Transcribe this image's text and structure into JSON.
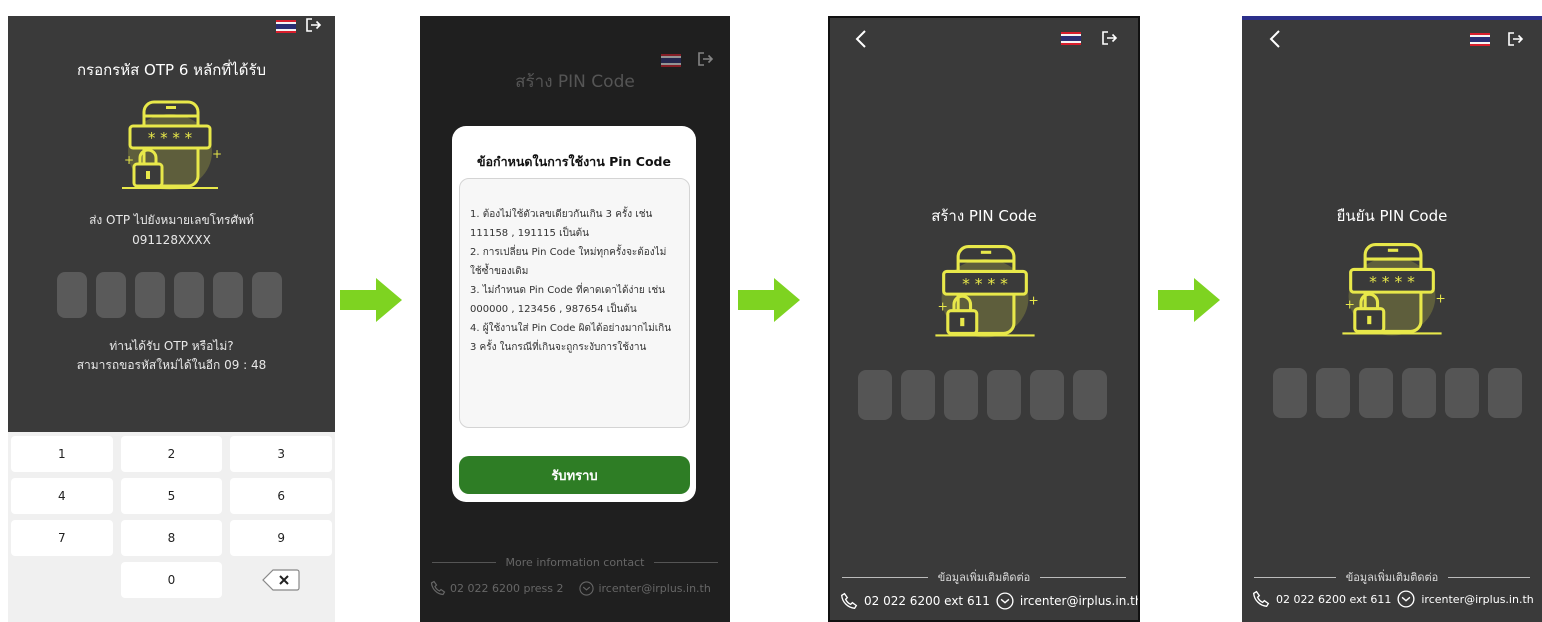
{
  "otp_screen": {
    "title": "กรอกรหัส OTP 6 หลักที่ได้รับ",
    "sent_line1": "ส่ง OTP ไปยังหมายเลขโทรศัพท์",
    "sent_line2": "091128XXXX",
    "otp_box_count": 6,
    "not_received": "ท่านได้รับ OTP หรือไม่?",
    "resend_countdown": "สามารถขอรหัสใหม่ได้ในอีก 09 : 48",
    "keypad": [
      "1",
      "2",
      "3",
      "4",
      "5",
      "6",
      "7",
      "8",
      "9",
      "",
      "0",
      "⌫"
    ]
  },
  "rules_screen": {
    "bg_title": "สร้าง PIN Code",
    "modal_title": "ข้อกำหนดในการใช้งาน Pin Code",
    "rules": [
      "1. ต้องไม่ใช้ตัวเลขเดียวกันเกิน 3 ครั้ง เช่น",
      "111158 , 191115 เป็นต้น",
      "2. การเปลี่ยน Pin Code ใหม่ทุกครั้งจะต้องไม่",
      "ใช้ซ้ำของเดิม",
      "3. ไม่กำหนด Pin Code ที่คาดเดาได้ง่าย เช่น",
      "000000 , 123456 , 987654 เป็นต้น",
      "4. ผู้ใช้งานใส่ Pin Code ผิดได้อย่างมากไม่เกิน",
      "3 ครั้ง ในกรณีที่เกินจะถูกระงับการใช้งาน"
    ],
    "accept_label": "รับทราบ",
    "contact_heading": "More information contact",
    "phone": "02 022 6200 press 2",
    "email": "ircenter@irplus.in.th"
  },
  "create_pin_screen": {
    "title": "สร้าง PIN Code",
    "pin_box_count": 6,
    "contact_heading": "ข้อมูลเพิ่มเติมติดต่อ",
    "phone": "02 022 6200 ext 611",
    "email": "ircenter@irplus.in.th"
  },
  "confirm_pin_screen": {
    "title": "ยืนยัน PIN Code",
    "pin_box_count": 6,
    "contact_heading": "ข้อมูลเพิ่มเติมติดต่อ",
    "phone": "02 022 6200 ext 611",
    "email": "ircenter@irplus.in.th"
  },
  "colors": {
    "screen_bg": "#3a3a3a",
    "accent_yellow": "#e8e84a",
    "button_green": "#2e7d25",
    "arrow_green": "#7ed321"
  },
  "icons": [
    "thai-flag-icon",
    "logout-icon",
    "back-chevron-icon",
    "phone-icon",
    "mail-icon",
    "backspace-icon",
    "otp-phone-lock-illustration",
    "flow-arrow-icon"
  ]
}
